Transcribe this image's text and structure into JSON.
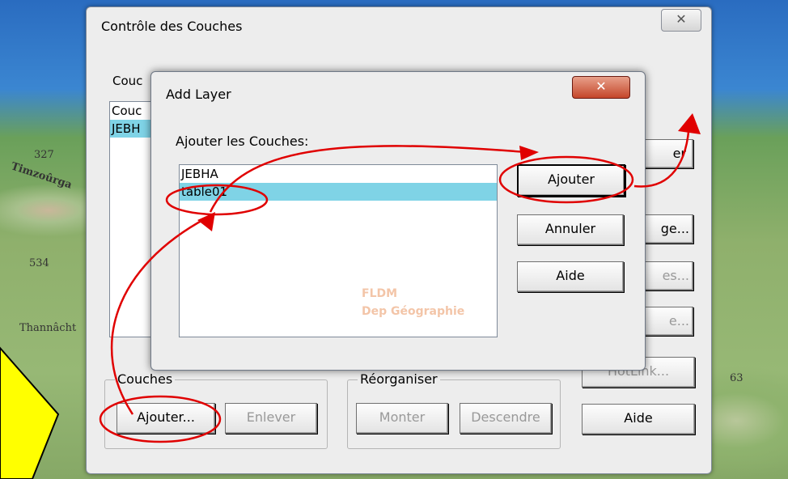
{
  "map": {
    "labels": [
      "327",
      "Timzoûrga",
      "534",
      "Thannâcht",
      "63"
    ]
  },
  "main_window": {
    "title": "Contrôle des Couches",
    "close_glyph": "✕",
    "layers_label_partial": "Couc",
    "layers_list": [
      "Couc",
      "JEBH"
    ],
    "right_buttons": [
      "er",
      "ge...",
      "es...",
      "e...",
      "HotLink...",
      "Aide"
    ],
    "group_couches": {
      "label": "Couches",
      "add": "Ajouter...",
      "remove": "Enlever"
    },
    "group_reorder": {
      "label": "Réorganiser",
      "up": "Monter",
      "down": "Descendre"
    }
  },
  "add_layer_dialog": {
    "title": "Add Layer",
    "close_glyph": "✕",
    "prompt": "Ajouter les Couches:",
    "items": [
      "JEBHA",
      "table01"
    ],
    "selected_index": 1,
    "buttons": {
      "add": "Ajouter",
      "cancel": "Annuler",
      "help": "Aide"
    },
    "watermark": [
      "FLDM",
      "Dep Géographie"
    ]
  },
  "annotation": {
    "arrow_color": "#e00000",
    "note_color": "#ffff00"
  }
}
